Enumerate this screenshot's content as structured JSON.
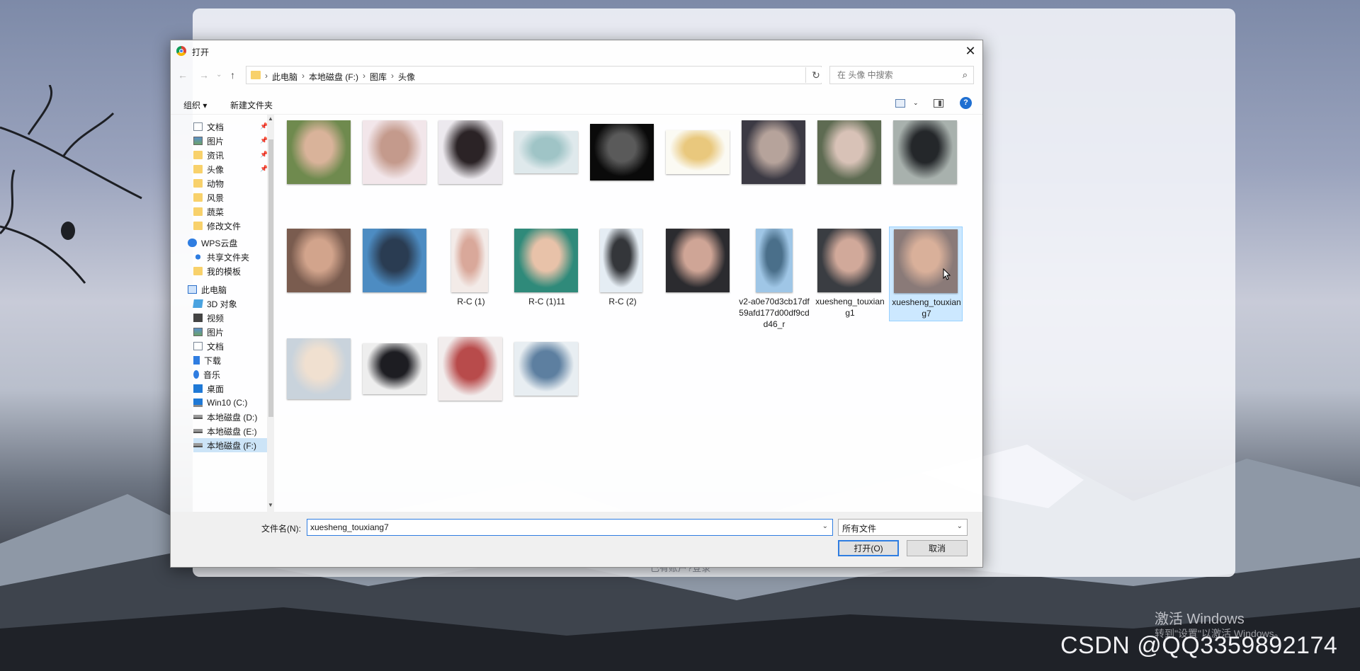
{
  "background": {
    "bgcard_footer": "已有账户?登录",
    "watermark_line1": "激活 Windows",
    "watermark_line2": "转到\"设置\"以激活 Windows。",
    "csdn": "CSDN @QQ3359892174"
  },
  "dialog": {
    "title": "打开",
    "close_glyph": "✕",
    "nav": {
      "back": "←",
      "forward": "→",
      "dropdown": "⌄",
      "up": "↑"
    },
    "breadcrumb": [
      "此电脑",
      "本地磁盘 (F:)",
      "图库",
      "头像"
    ],
    "breadcrumb_sep": "›",
    "refresh_glyph": "↻",
    "search_placeholder": "在 头像 中搜索",
    "search_glyph": "⌕",
    "toolbar": {
      "organize": "组织 ▾",
      "new_folder": "新建文件夹",
      "help": "?"
    },
    "sidebar": [
      {
        "label": "文档",
        "icon": "document-icon",
        "pinned": true
      },
      {
        "label": "图片",
        "icon": "picture-icon",
        "pinned": true
      },
      {
        "label": "资讯",
        "icon": "folder-icon",
        "pinned": true
      },
      {
        "label": "头像",
        "icon": "folder-icon",
        "pinned": true
      },
      {
        "label": "动物",
        "icon": "folder-icon"
      },
      {
        "label": "风景",
        "icon": "folder-icon"
      },
      {
        "label": "蔬菜",
        "icon": "folder-icon"
      },
      {
        "label": "修改文件",
        "icon": "folder-icon"
      },
      {
        "label": "WPS云盘",
        "icon": "cloud-icon"
      },
      {
        "label": "共享文件夹",
        "icon": "share-icon"
      },
      {
        "label": "我的模板",
        "icon": "folder-icon"
      },
      {
        "label": "此电脑",
        "icon": "computer-icon"
      },
      {
        "label": "3D 对象",
        "icon": "3d-objects-icon"
      },
      {
        "label": "视频",
        "icon": "video-icon"
      },
      {
        "label": "图片",
        "icon": "picture-icon"
      },
      {
        "label": "文档",
        "icon": "document-icon"
      },
      {
        "label": "下载",
        "icon": "download-icon"
      },
      {
        "label": "音乐",
        "icon": "music-icon"
      },
      {
        "label": "桌面",
        "icon": "desktop-icon"
      },
      {
        "label": "Win10 (C:)",
        "icon": "windows-drive-icon"
      },
      {
        "label": "本地磁盘 (D:)",
        "icon": "drive-icon"
      },
      {
        "label": "本地磁盘 (E:)",
        "icon": "drive-icon"
      },
      {
        "label": "本地磁盘 (F:)",
        "icon": "drive-icon"
      }
    ],
    "files": [
      {
        "name": "",
        "colors": [
          "#6f8a4e",
          "#d9b39a"
        ]
      },
      {
        "name": "",
        "colors": [
          "#f2e6ea",
          "#c49a8c"
        ]
      },
      {
        "name": "",
        "colors": [
          "#ece9ee",
          "#2b2326"
        ]
      },
      {
        "name": "",
        "colors": [
          "#dfe9ec",
          "#9fc4c6"
        ]
      },
      {
        "name": "",
        "colors": [
          "#0a0a0a",
          "#5a5a5a"
        ]
      },
      {
        "name": "",
        "colors": [
          "#fbfaf3",
          "#e9c87d"
        ]
      },
      {
        "name": "",
        "colors": [
          "#3c3a44",
          "#b6a39b"
        ]
      },
      {
        "name": "",
        "colors": [
          "#5e6b52",
          "#d8c2b7"
        ]
      },
      {
        "name": "",
        "colors": [
          "#a8b1ad",
          "#24272a"
        ]
      },
      {
        "name": "",
        "colors": [
          "#7a5c4f",
          "#d2a48c"
        ]
      },
      {
        "name": "",
        "colors": [
          "#4d8cc2",
          "#2a3c52"
        ]
      },
      {
        "name": "R-C (1)",
        "colors": [
          "#f3ebe8",
          "#d9a89a"
        ]
      },
      {
        "name": "R-C (1)11",
        "colors": [
          "#2f8a7a",
          "#e8c2a9"
        ]
      },
      {
        "name": "R-C (2)",
        "colors": [
          "#e5edf4",
          "#34363a"
        ]
      },
      {
        "name": "",
        "colors": [
          "#2b2b2f",
          "#cfa596"
        ]
      },
      {
        "name": "v2-a0e70d3cb17df59afd177d00df9cdd46_r",
        "colors": [
          "#9fc6e6",
          "#4a6f8a"
        ]
      },
      {
        "name": "xuesheng_touxiang1",
        "colors": [
          "#3a3d42",
          "#d1a99a"
        ]
      },
      {
        "name": "xuesheng_touxiang7",
        "colors": [
          "#8a7a78",
          "#d9b09a"
        ]
      },
      {
        "name": "",
        "colors": [
          "#c9d3dc",
          "#f0e0d0"
        ]
      },
      {
        "name": "",
        "colors": [
          "#eeeeee",
          "#1d1d22"
        ]
      },
      {
        "name": "",
        "colors": [
          "#f2eded",
          "#b84b4b"
        ]
      },
      {
        "name": "",
        "colors": [
          "#e8eef2",
          "#5d7fa0"
        ]
      }
    ],
    "selected_file_index": 17,
    "filename_label": "文件名(N):",
    "filename_value": "xuesheng_touxiang7",
    "filetype_value": "所有文件",
    "dropdown_glyph": "⌄",
    "open_button": "打开(O)",
    "cancel_button": "取消"
  }
}
